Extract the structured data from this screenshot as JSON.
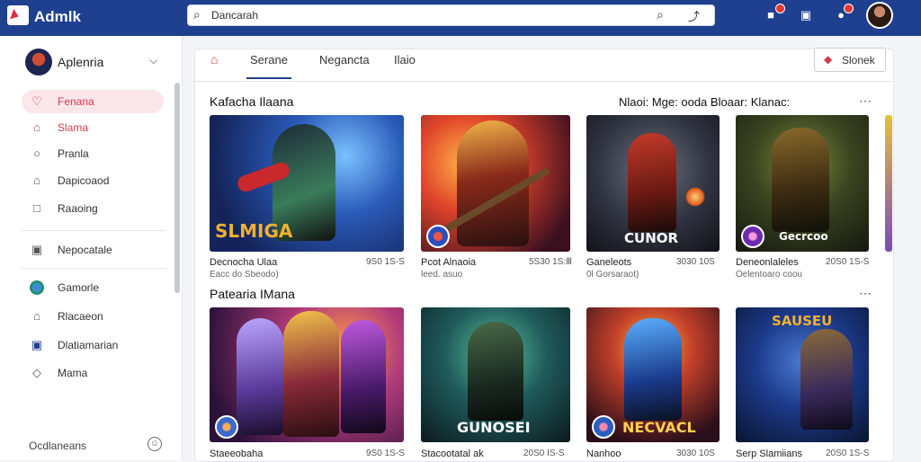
{
  "app": {
    "brand": "Admlk"
  },
  "search": {
    "value": "Dancarah"
  },
  "sidebar": {
    "profile_name": "Aplenria",
    "items": [
      {
        "label": "Fenana",
        "icon": "heart-icon"
      },
      {
        "label": "Slama",
        "icon": "bag-icon"
      },
      {
        "label": "Pranla",
        "icon": "pin-icon"
      },
      {
        "label": "Dapicoaod",
        "icon": "home-icon"
      },
      {
        "label": "Raaoing",
        "icon": "box-icon"
      },
      {
        "label": "Nepocatale",
        "icon": "gamepad-icon"
      },
      {
        "label": "Gamorle",
        "icon": "game-avatar-icon"
      },
      {
        "label": "Rlacaeon",
        "icon": "house-icon"
      },
      {
        "label": "Dlatiamarian",
        "icon": "calendar-icon"
      },
      {
        "label": "Mama",
        "icon": "fire-icon"
      }
    ],
    "bottom_label": "Ocdlaneans"
  },
  "tabs": [
    "Serane",
    "Negancta",
    "Ilaio"
  ],
  "stock_button": "Slonek",
  "sections": [
    {
      "title": "Kafacha Ilaana",
      "right_label": "Nlaoi: Mge: ooda Bloaar: Klanac:"
    },
    {
      "title": "Patearia IMana"
    }
  ],
  "row1": [
    {
      "name": "Decnocha Ulaa",
      "sub": "Eacc do Sbeodo)",
      "meta": "9S0 1S-S",
      "overlay": "SLMIGA"
    },
    {
      "name": "Pcot Alnaoia",
      "sub": "leed. asuo",
      "meta": "5S30 1S:Ⅲ",
      "overlay": ""
    },
    {
      "name": "Ganeleots",
      "sub": "0l Gorsaraot)",
      "meta": "3030 10S",
      "overlay": "CUNOR"
    },
    {
      "name": "Deneonlaleles",
      "sub": "Oelentoaro coou",
      "meta": "20S0 1S-S",
      "overlay": "Gecrcoo"
    }
  ],
  "row2": [
    {
      "name": "Staeeobaha",
      "meta": "9S0 1S-S",
      "overlay": ""
    },
    {
      "name": "Stacootatal ak",
      "meta": "20S0 IS-S",
      "overlay": "GUNOSEI"
    },
    {
      "name": "Nanhoo",
      "meta": "3030 10S",
      "overlay": "NECVACL"
    },
    {
      "name": "Serp Slamiians",
      "meta": "20S0 1S-S",
      "overlay": "SAUSEU"
    }
  ]
}
